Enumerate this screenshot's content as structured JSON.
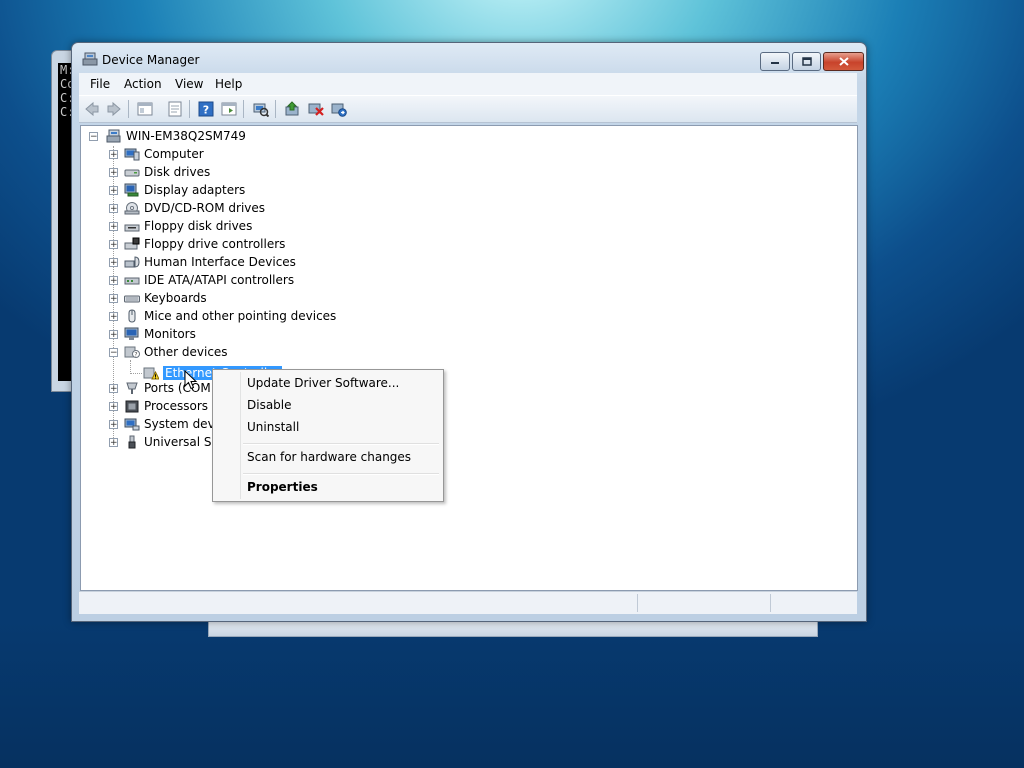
{
  "console": {
    "lines": [
      "M:",
      "Co",
      "",
      "C:",
      "",
      "C:"
    ]
  },
  "window": {
    "title": "Device Manager"
  },
  "menu": {
    "items": [
      "File",
      "Action",
      "View",
      "Help"
    ]
  },
  "tree": {
    "root": "WIN-EM38Q2SM749",
    "categories": [
      {
        "label": "Computer",
        "icon": "computer-icon"
      },
      {
        "label": "Disk drives",
        "icon": "disk-drive-icon"
      },
      {
        "label": "Display adapters",
        "icon": "display-adapter-icon"
      },
      {
        "label": "DVD/CD-ROM drives",
        "icon": "dvd-drive-icon"
      },
      {
        "label": "Floppy disk drives",
        "icon": "floppy-disk-icon"
      },
      {
        "label": "Floppy drive controllers",
        "icon": "floppy-controller-icon"
      },
      {
        "label": "Human Interface Devices",
        "icon": "hid-icon"
      },
      {
        "label": "IDE ATA/ATAPI controllers",
        "icon": "ide-controller-icon"
      },
      {
        "label": "Keyboards",
        "icon": "keyboard-icon"
      },
      {
        "label": "Mice and other pointing devices",
        "icon": "mouse-icon"
      },
      {
        "label": "Monitors",
        "icon": "monitor-icon"
      },
      {
        "label": "Other devices",
        "icon": "unknown-device-icon"
      },
      {
        "label": "Ports (COM &",
        "icon": "port-icon"
      },
      {
        "label": "Processors",
        "icon": "processor-icon"
      },
      {
        "label": "System devic",
        "icon": "system-device-icon"
      },
      {
        "label": "Universal Seri",
        "icon": "usb-icon"
      }
    ],
    "child": {
      "label": "Ethernet Controller",
      "icon": "warning-device-icon"
    }
  },
  "context_menu": {
    "update": "Update Driver Software...",
    "disable": "Disable",
    "uninstall": "Uninstall",
    "scan": "Scan for hardware changes",
    "properties": "Properties"
  },
  "colors": {
    "selection": "#3399ff",
    "close_button": "#c8432b"
  }
}
